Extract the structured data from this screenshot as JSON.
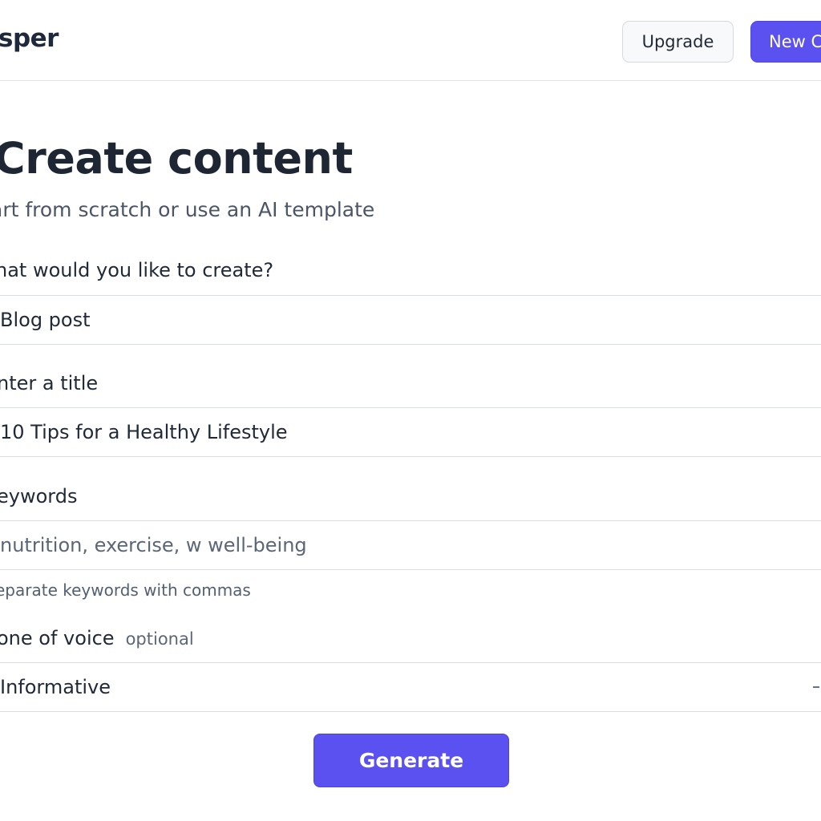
{
  "header": {
    "brand": "sper",
    "upgrade_label": "Upgrade",
    "new_label": "New C"
  },
  "main": {
    "title": "Create content",
    "subtitle": "art from scratch or use an AI template"
  },
  "form": {
    "type_label": "hat would you like to create?",
    "type_value": "Blog post",
    "title_label": "nter a title",
    "title_value": "10 Tips for a Healthy Lifestyle",
    "keywords_label": "eywords",
    "keywords_placeholder": "nutrition, exercise, w well-being",
    "keywords_helper": "eparate keywords with commas",
    "tone_label": "one of voice",
    "tone_optional": "optional",
    "tone_value": "Informative",
    "generate_label": "Generate"
  },
  "colors": {
    "accent": "#5b50f0",
    "text": "#1f2937",
    "muted": "#5b6676",
    "border": "#d9dee4"
  },
  "icons": {
    "tone_dropdown": "chevron-down-icon"
  }
}
